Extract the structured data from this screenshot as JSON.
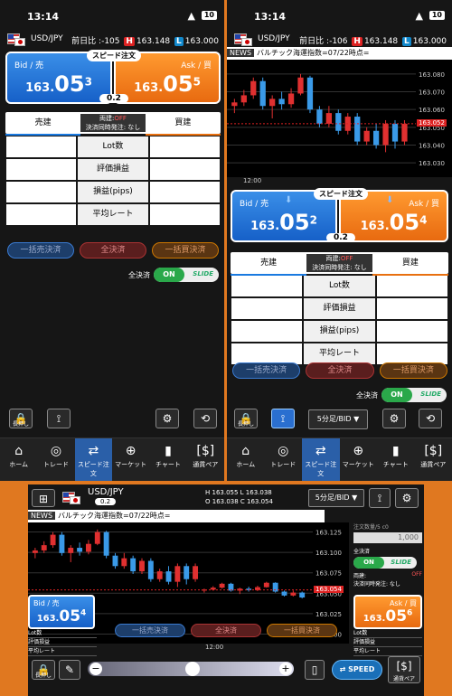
{
  "status": {
    "time": "13:14",
    "battery": "10"
  },
  "pair": {
    "name": "USD/JPY",
    "change_label": "前日比 :",
    "high_tag": "H",
    "low_tag": "L",
    "open_tag": "O",
    "close_tag": "C"
  },
  "p1": {
    "change": "-105",
    "high": "163.148",
    "low": "163.000",
    "bid_int": "163.",
    "bid_big": "05",
    "bid_sup": "3",
    "ask_int": "163.",
    "ask_big": "05",
    "ask_sup": "5",
    "spread": "0.2"
  },
  "p2": {
    "change": "-106",
    "high": "163.148",
    "low": "163.000",
    "bid_int": "163.",
    "bid_big": "05",
    "bid_sup": "2",
    "ask_int": "163.",
    "ask_big": "05",
    "ask_sup": "4",
    "spread": "0.2",
    "timeframe": "5分足/BID ▼",
    "price_tag": "163.052",
    "time_label": "12:00"
  },
  "p3": {
    "spread": "0.2",
    "hl": "H 163.055 L 163.038",
    "oc": "O 163.038 C 163.054",
    "timeframe": "5分足/BID ▼",
    "bid_int": "163.",
    "bid_big": "05",
    "bid_sup": "4",
    "ask_int": "163.",
    "ask_big": "05",
    "ask_sup": "6",
    "price_tag": "163.054",
    "time_label": "12:00",
    "order_qty_label": "注文数量/5 c0",
    "qty_value": "1,000",
    "speed": "SPEED",
    "pair_btn": "通貨ペア"
  },
  "labels": {
    "speed_order": "スピード注文",
    "bid": "Bid / 売",
    "ask": "Ask / 買",
    "sell": "売建",
    "buy": "買建",
    "both_label": "両建:",
    "off": "OFF",
    "settle_label": "決済同時発注: なし",
    "lot": "Lot数",
    "eval": "評価損益",
    "pips": "損益(pips)",
    "avg": "平均レート",
    "sell_close": "一括売決済",
    "all_close": "全決済",
    "buy_close": "一括買決済",
    "all_close_label": "全決済",
    "on": "ON",
    "slide": "SLIDE",
    "longpress": "長押し",
    "news_tag": "NEWS",
    "news_text": "バルチック海運指数=07/22時点=",
    "lot_short": "Lot数",
    "eval_short": "評価損益",
    "avg_short": "平均レート",
    "both_short": "両建:",
    "settle_short": "決済同時発注: なし"
  },
  "nav": [
    {
      "icon": "⌂",
      "label": "ホーム"
    },
    {
      "icon": "◎",
      "label": "トレード"
    },
    {
      "icon": "⇄",
      "label": "スピード注文"
    },
    {
      "icon": "⊕",
      "label": "マーケット"
    },
    {
      "icon": "▮",
      "label": "チャート"
    },
    {
      "icon": "[$]",
      "label": "通貨ペア"
    }
  ],
  "axis_p2": [
    "163.080",
    "163.070",
    "163.060",
    "163.050",
    "163.040",
    "163.030"
  ],
  "axis_p3": [
    "163.125",
    "163.100",
    "163.075",
    "163.050",
    "163.025",
    "163.000"
  ],
  "colors": {
    "bid": "#1a6fd8",
    "ask": "#f07a18",
    "up": "#e03030",
    "down": "#3a9ae8"
  },
  "chart_data": {
    "type": "candlestick",
    "note_none": "",
    "p2_candles": [
      [
        163.062,
        163.066,
        163.058,
        163.064
      ],
      [
        163.064,
        163.071,
        163.062,
        163.068
      ],
      [
        163.068,
        163.078,
        163.066,
        163.076
      ],
      [
        163.076,
        163.078,
        163.06,
        163.062
      ],
      [
        163.062,
        163.068,
        163.055,
        163.066
      ],
      [
        163.066,
        163.07,
        163.06,
        163.063
      ],
      [
        163.063,
        163.072,
        163.061,
        163.069
      ],
      [
        163.069,
        163.08,
        163.068,
        163.078
      ],
      [
        163.078,
        163.079,
        163.058,
        163.06
      ],
      [
        163.06,
        163.062,
        163.05,
        163.052
      ],
      [
        163.052,
        163.062,
        163.05,
        163.058
      ],
      [
        163.058,
        163.06,
        163.046,
        163.048
      ],
      [
        163.048,
        163.058,
        163.046,
        163.056
      ],
      [
        163.056,
        163.058,
        163.04,
        163.042
      ],
      [
        163.042,
        163.05,
        163.04,
        163.048
      ],
      [
        163.048,
        163.052,
        163.038,
        163.04
      ],
      [
        163.04,
        163.054,
        163.036,
        163.052
      ],
      [
        163.052,
        163.054,
        163.038,
        163.042
      ],
      [
        163.042,
        163.054,
        163.04,
        163.052
      ]
    ]
  }
}
